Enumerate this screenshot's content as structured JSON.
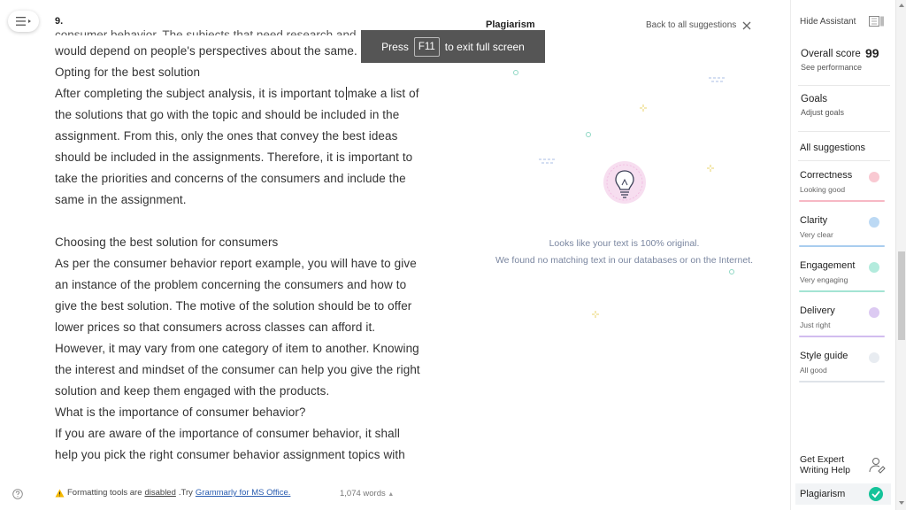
{
  "document": {
    "paragraph_number": "9.",
    "cut_line": "consumer behavior. The subjects that need research and",
    "lines": [
      "would depend on people's perspectives about the same.",
      "Opting for the best solution",
      "After completing the subject analysis, it is important to",
      "make a list of",
      "the solutions that go with the topic and should be included in the",
      "assignment. From this, only the ones that convey the best ideas",
      "should be included in the assignments. Therefore, it is important to",
      "take the priorities and concerns of the consumers and include the",
      "same in the assignment.",
      "Choosing the best solution for consumers",
      "As per the consumer behavior report example, you will have to give",
      "an instance of the problem concerning the consumers and how to",
      "give the best solution. The motive of the solution should be to offer",
      "lower prices so that consumers across classes can afford it.",
      "However, it may vary from one category of item to another. Knowing",
      "the interest and mindset of the consumer can help you give the right",
      "solution and keep them engaged with the products.",
      "What is the importance of consumer behavior?",
      "If you are aware of the importance of consumer behavior, it shall",
      "help you pick the right consumer behavior assignment topics with"
    ]
  },
  "fullscreen_banner": {
    "press": "Press",
    "key": "F11",
    "suffix": "to exit full screen"
  },
  "plagiarism_panel": {
    "title": "Plagiarism",
    "back_link": "Back to all suggestions",
    "message_line1": "Looks like your text is 100% original.",
    "message_line2": "We found no matching text in our databases or on the Internet."
  },
  "sidebar": {
    "hide_assistant": "Hide Assistant",
    "overall_score_label": "Overall score",
    "overall_score_value": "99",
    "see_performance": "See performance",
    "goals": "Goals",
    "adjust_goals": "Adjust goals",
    "all_suggestions": "All suggestions",
    "categories": [
      {
        "name": "Correctness",
        "status": "Looking good",
        "color": "#f27a8e"
      },
      {
        "name": "Clarity",
        "status": "Very clear",
        "color": "#4a9de0"
      },
      {
        "name": "Engagement",
        "status": "Very engaging",
        "color": "#1fc0a0"
      },
      {
        "name": "Delivery",
        "status": "Just right",
        "color": "#9b6bd6"
      },
      {
        "name": "Style guide",
        "status": "All good",
        "color": "#cdd3dc"
      }
    ],
    "expert_line1": "Get Expert",
    "expert_line2": "Writing Help",
    "plagiarism": "Plagiarism"
  },
  "footer": {
    "warning_text": "Formatting tools are",
    "warning_disabled": "disabled",
    "warning_try": ".Try",
    "warning_link": "Grammarly for MS Office.",
    "word_count": "1,074 words"
  },
  "colors": {
    "accent_green": "#15c39a",
    "message_text": "#7a86a0",
    "bulb_pink": "#f5d6ee"
  }
}
